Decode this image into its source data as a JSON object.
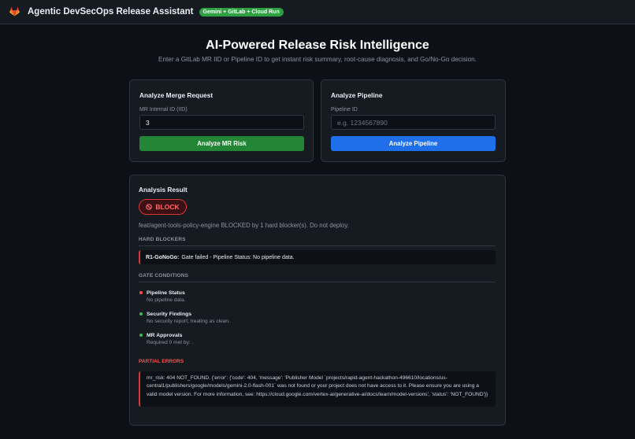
{
  "header": {
    "title": "Agentic DevSecOps Release Assistant",
    "badge": "Gemini + GitLab + Cloud Run"
  },
  "hero": {
    "title": "AI-Powered Release Risk Intelligence",
    "subtitle": "Enter a GitLab MR IID or Pipeline ID to get instant risk summary, root-cause diagnosis, and Go/No-Go decision."
  },
  "mr_card": {
    "title": "Analyze Merge Request",
    "field_label": "MR Internal ID (IID)",
    "value": "3",
    "placeholder": "",
    "button": "Analyze MR Risk"
  },
  "pipeline_card": {
    "title": "Analyze Pipeline",
    "field_label": "Pipeline ID",
    "value": "",
    "placeholder": "e.g. 1234567890",
    "button": "Analyze Pipeline"
  },
  "result": {
    "title": "Analysis Result",
    "decision": "BLOCK",
    "summary": "feat/agent-tools-policy-engine BLOCKED by 1 hard blocker(s). Do not deploy.",
    "hard_blockers_heading": "HARD BLOCKERS",
    "blockers": [
      {
        "id": "R1-GoNoGo:",
        "text": "Gate failed - Pipeline Status: No pipeline data."
      }
    ],
    "gate_conditions_heading": "GATE CONDITIONS",
    "gates": [
      {
        "name": "Pipeline Status",
        "detail": "No pipeline data.",
        "status": "fail"
      },
      {
        "name": "Security Findings",
        "detail": "No security report; treating as clean.",
        "status": "pass"
      },
      {
        "name": "MR Approvals",
        "detail": "Required 0 met by: .",
        "status": "pass"
      }
    ],
    "partial_errors_heading": "PARTIAL ERRORS",
    "partial_error": "mr_risk: 404 NOT_FOUND. {'error': {'code': 404, 'message': 'Publisher Model `projects/rapid-agent-hackathon-496610/locations/us-central1/publishers/google/models/gemini-2.0-flash-001` was not found or your project does not have access to it. Please ensure you are using a valid model version. For more information, see: https://cloud.google.com/vertex-ai/generative-ai/docs/learn/model-versions', 'status': 'NOT_FOUND'}}"
  },
  "colors": {
    "background": "#0d1117",
    "card": "#161b22",
    "border": "#30363d",
    "green": "#238636",
    "blue": "#1f6feb",
    "red": "#da3633",
    "gitlab_orange": "#fc6d26"
  },
  "icons": {
    "logo": "gitlab-logo-icon",
    "block": "block-icon"
  }
}
